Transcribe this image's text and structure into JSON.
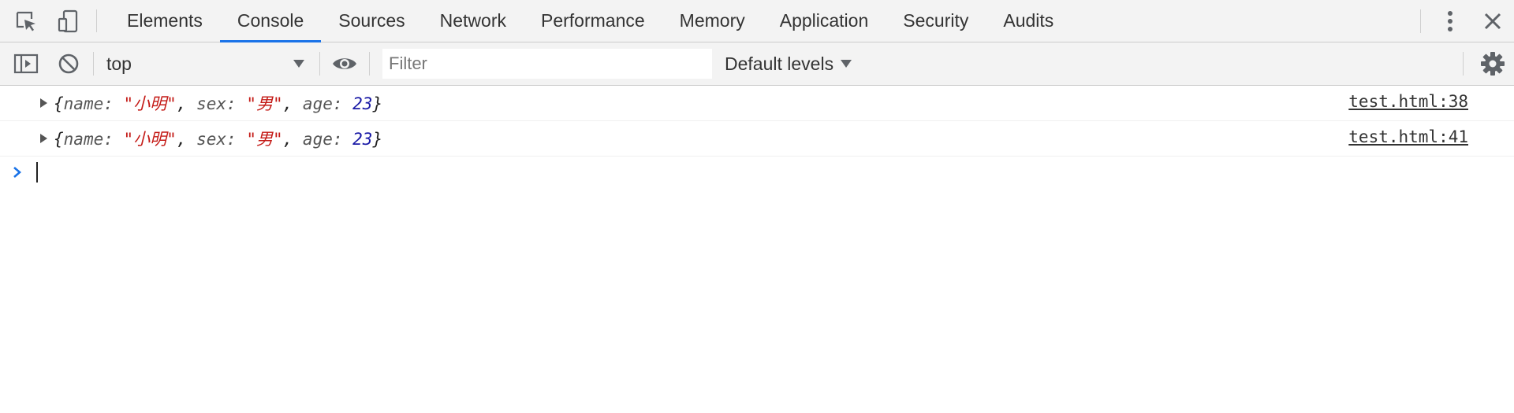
{
  "devtools": {
    "tabs": [
      {
        "label": "Elements"
      },
      {
        "label": "Console"
      },
      {
        "label": "Sources"
      },
      {
        "label": "Network"
      },
      {
        "label": "Performance"
      },
      {
        "label": "Memory"
      },
      {
        "label": "Application"
      },
      {
        "label": "Security"
      },
      {
        "label": "Audits"
      }
    ],
    "active_tab": "Console",
    "accent_color": "#1a73e8"
  },
  "toolbar": {
    "context": "top",
    "filter_placeholder": "Filter",
    "levels_label": "Default levels"
  },
  "console": {
    "messages": [
      {
        "open": "{",
        "k1": "name: ",
        "v1": "\"小明\"",
        "sep1": ", ",
        "k2": "sex: ",
        "v2": "\"男\"",
        "sep2": ", ",
        "k3": "age: ",
        "v3": "23",
        "close": "}",
        "source": "test.html:38"
      },
      {
        "open": "{",
        "k1": "name: ",
        "v1": "\"小明\"",
        "sep1": ", ",
        "k2": "sex: ",
        "v2": "\"男\"",
        "sep2": ", ",
        "k3": "age: ",
        "v3": "23",
        "close": "}",
        "source": "test.html:41"
      }
    ],
    "string_color": "#c41a16",
    "number_color": "#1a1aa6"
  }
}
